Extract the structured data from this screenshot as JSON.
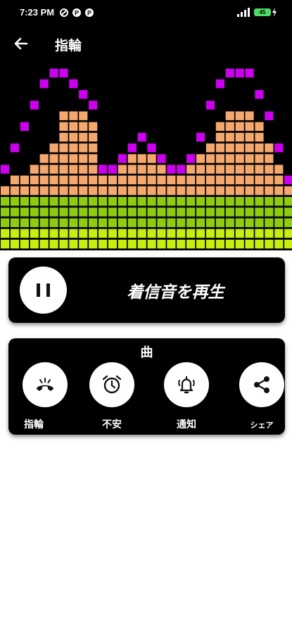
{
  "status_bar": {
    "time": "7:23 PM",
    "battery": "45",
    "icons": [
      "data-saver-icon",
      "notification-icon",
      "notification-icon",
      "signal-icon",
      "battery-icon",
      "charging-icon"
    ]
  },
  "app_bar": {
    "title": "指輪",
    "back_icon": "arrow-left-icon"
  },
  "visualizer": {
    "colors": {
      "cap": "#cc00ee",
      "bar_peach": "#f4a86e",
      "bar_green": "#8fcc10",
      "bar_lime": "#c8ee10"
    }
  },
  "player": {
    "play_label": "着信音を再生",
    "pause_icon": "pause-icon"
  },
  "actions": {
    "section_title": "曲",
    "items": [
      {
        "label": "指輪",
        "icon": "phone-ring-icon"
      },
      {
        "label": "不安",
        "icon": "alarm-clock-icon"
      },
      {
        "label": "通知",
        "icon": "bell-ring-icon"
      },
      {
        "label": "シェア",
        "icon": "share-icon"
      }
    ]
  }
}
